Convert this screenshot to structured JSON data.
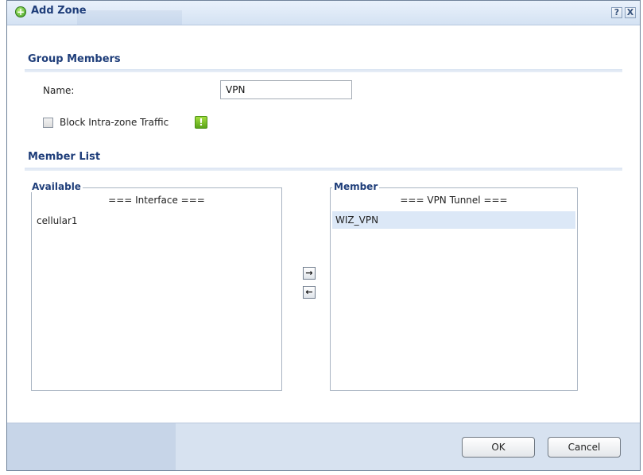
{
  "dialog": {
    "title": "Add Zone",
    "help_label": "?",
    "close_label": "X",
    "ghost_tab_label": ""
  },
  "group_members": {
    "section_title": "Group Members",
    "name_label": "Name:",
    "name_value": "VPN",
    "block_traffic_label": "Block Intra-zone Traffic",
    "block_traffic_checked": false,
    "warning_icon": "!"
  },
  "member_list": {
    "section_title": "Member List",
    "available": {
      "legend": "Available",
      "header": "=== Interface ===",
      "items": [
        "cellular1"
      ]
    },
    "member": {
      "legend": "Member",
      "header": "=== VPN Tunnel ===",
      "items": [
        "WIZ_VPN"
      ]
    },
    "add_arrow": "→",
    "remove_arrow": "←"
  },
  "footer": {
    "ok_label": "OK",
    "cancel_label": "Cancel"
  },
  "colors": {
    "accent": "#1f3e7a",
    "selection": "#dce8f7",
    "footer_bg": "#d7e2f0"
  }
}
